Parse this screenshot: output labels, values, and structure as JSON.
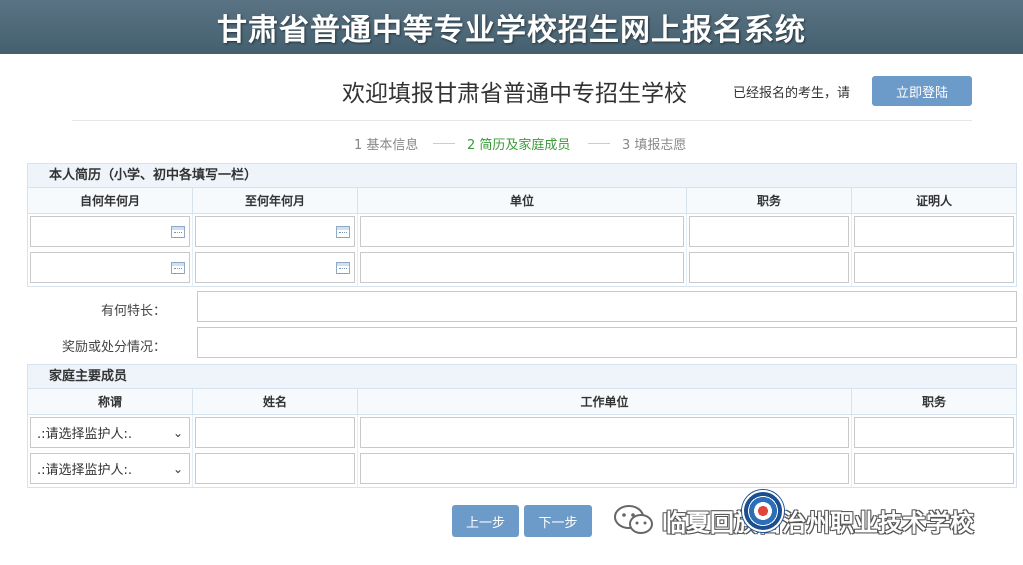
{
  "banner": {
    "title": "甘肃省普通中等专业学校招生网上报名系统"
  },
  "header": {
    "welcome": "欢迎填报甘肃省普通中专招生学校",
    "registered_note": "已经报名的考生，请",
    "login_button": "立即登陆"
  },
  "steps": [
    {
      "label": "1 基本信息",
      "active": false
    },
    {
      "label": "2 简历及家庭成员",
      "active": true
    },
    {
      "label": "3 填报志愿",
      "active": false
    }
  ],
  "resume": {
    "heading": "本人简历（小学、初中各填写一栏）",
    "columns": [
      "自何年何月",
      "至何年何月",
      "单位",
      "职务",
      "证明人"
    ]
  },
  "specialty": {
    "label": "有何特长：",
    "value": ""
  },
  "awards": {
    "label": "奖励或处分情况：",
    "value": ""
  },
  "family": {
    "heading": "家庭主要成员",
    "columns": [
      "称谓",
      "姓名",
      "工作单位",
      "职务"
    ],
    "relation_placeholder": ".:请选择监护人:."
  },
  "nav": {
    "prev": "上一步",
    "next": "下一步"
  },
  "watermark": {
    "text": "临夏回族自治州职业技术学校"
  },
  "colors": {
    "banner": "#4f6a7a",
    "accent": "#6c9bc9",
    "active_step": "#3a9a3a"
  }
}
